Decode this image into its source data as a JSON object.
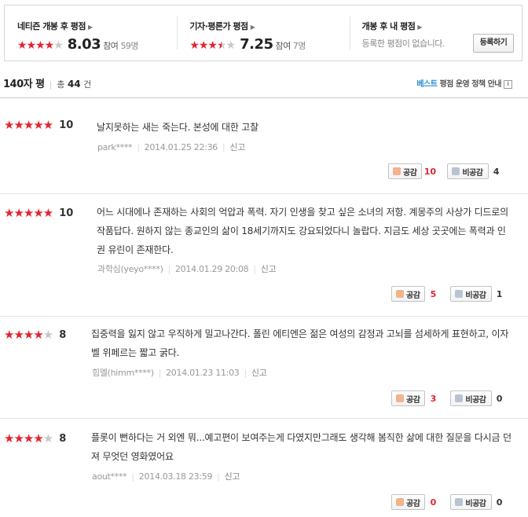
{
  "ratings": {
    "netizen": {
      "title": "네티즌 개봉 후 평점",
      "score": "8.03",
      "participants_prefix": "참여",
      "participants": "59명",
      "stars": 4
    },
    "critic": {
      "title": "기자·평론가 평점",
      "score": "7.25",
      "participants_prefix": "참여",
      "participants": "7명",
      "stars": 3.5
    },
    "mine": {
      "title": "개봉 후 내 평점",
      "desc": "등록한 평점이 없습니다.",
      "register_label": "등록하기"
    }
  },
  "list_header": {
    "title": "140자 평",
    "total_label": "총",
    "total_count": "44",
    "total_unit": "건",
    "policy_best": "베스트",
    "policy_rest": "평점 운영 정책 안내"
  },
  "reviews": [
    {
      "stars": 5,
      "score": "10",
      "text": "날지못하는 새는 죽는다. 본성에 대한 고찰",
      "author": "park****",
      "date": "2014.01.25 22:36",
      "report": "신고",
      "like_label": "공감",
      "likes": "10",
      "dislike_label": "비공감",
      "dislikes": "4"
    },
    {
      "stars": 5,
      "score": "10",
      "text": "어느 시대에나 존재하는 사회의 억압과 폭력. 자기 인생을 찾고 싶은 소녀의 저항. 계몽주의 사상가 디드로의 작품답다. 원하지 않는 종교인의 삶이 18세기까지도 강요되었다니 놀랍다. 지금도 세상 곳곳에는 폭력과 인권 유린이 존재한다.",
      "author": "과학심(yeyo****)",
      "date": "2014.01.29 20:08",
      "report": "신고",
      "like_label": "공감",
      "likes": "5",
      "dislike_label": "비공감",
      "dislikes": "1"
    },
    {
      "stars": 4,
      "score": "8",
      "text": "집중력을 잃지 않고 우직하게 밀고나간다. 폴린 에티엔은 젊은 여성의 감정과 고뇌를 섬세하게 표현하고, 이자벨 위페르는 짧고 굵다.",
      "author": "힘멜(himm****)",
      "date": "2014.01.23 11:03",
      "report": "신고",
      "like_label": "공감",
      "likes": "3",
      "dislike_label": "비공감",
      "dislikes": "0"
    },
    {
      "stars": 4,
      "score": "8",
      "text": "플롯이 뻔하다는 거 외엔 뭐...예고편이 보여주는게 다였지만그래도 생각해 봄직한 삶에 대한 질문을 다시금 던져 무엇던 영화였어요",
      "author": "aout****",
      "date": "2014.03.18 23:59",
      "report": "신고",
      "like_label": "공감",
      "likes": "0",
      "dislike_label": "비공감",
      "dislikes": "0"
    }
  ],
  "colors": {
    "star_on": "#e3232f",
    "star_off": "#c8c8c8",
    "best": "#2a8fd6"
  }
}
